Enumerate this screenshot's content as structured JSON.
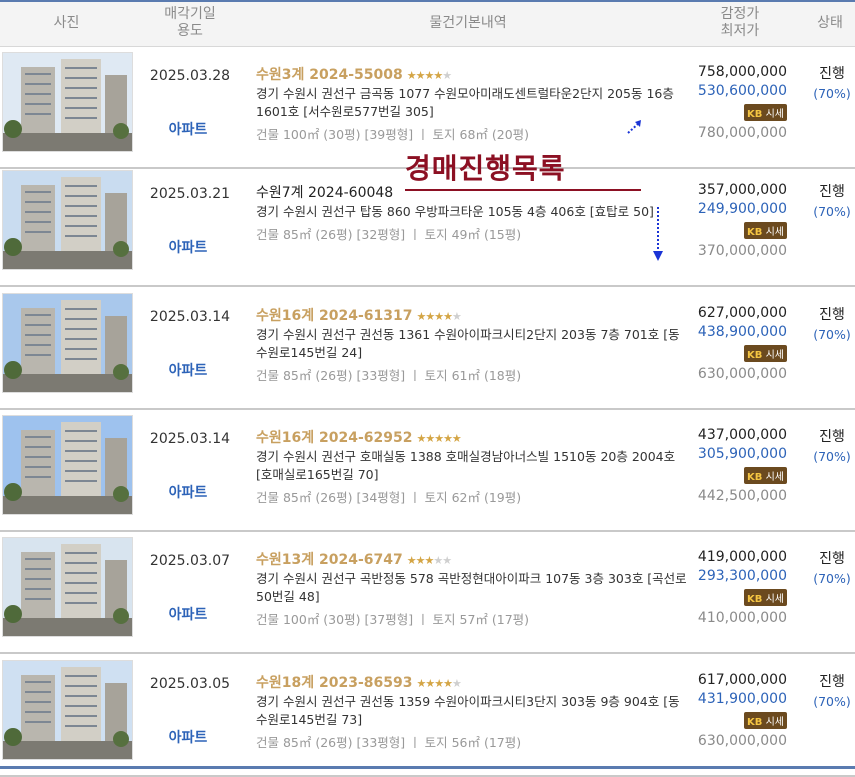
{
  "header": {
    "photo": "사진",
    "date_line1": "매각기일",
    "date_line2": "용도",
    "info": "물건기본내역",
    "price_line1": "감정가",
    "price_line2": "최저가",
    "status": "상태"
  },
  "overlay": {
    "title": "경매진행목록"
  },
  "rows": [
    {
      "date": "2025.03.28",
      "usage": "아파트",
      "case": "수원3계 2024-55008",
      "stars": 4,
      "case_style": "gold",
      "address": "경기 수원시 권선구 금곡동 1077 수원모아미래도센트럴타운2단지 205동 16층 1601호 [서수원로577번길 305]",
      "area": "건물 100㎡ (30평) [39평형]  ㅣ  토지 68㎡ (20평)",
      "appraisal": "758,000,000",
      "minimum": "530,600,000",
      "sale": "780,000,000",
      "sise": "시세",
      "status": "진행",
      "ratio": "(70%)"
    },
    {
      "date": "2025.03.21",
      "usage": "아파트",
      "case": "수원7계 2024-60048",
      "stars": 0,
      "case_style": "black",
      "address": "경기 수원시 권선구 탑동 860 우방파크타운 105동 4층 406호 [효탑로 50]",
      "area": "건물 85㎡ (26평) [32평형]  ㅣ  토지 49㎡ (15평)",
      "appraisal": "357,000,000",
      "minimum": "249,900,000",
      "sale": "370,000,000",
      "sise": "시세",
      "status": "진행",
      "ratio": "(70%)"
    },
    {
      "date": "2025.03.14",
      "usage": "아파트",
      "case": "수원16계 2024-61317",
      "stars": 4,
      "case_style": "gold",
      "address": "경기 수원시 권선구 권선동 1361 수원아이파크시티2단지 203동 7층 701호 [동수원로145번길 24]",
      "area": "건물 85㎡ (26평) [33평형]  ㅣ  토지 61㎡ (18평)",
      "appraisal": "627,000,000",
      "minimum": "438,900,000",
      "sale": "630,000,000",
      "sise": "시세",
      "status": "진행",
      "ratio": "(70%)"
    },
    {
      "date": "2025.03.14",
      "usage": "아파트",
      "case": "수원16계 2024-62952",
      "stars": 5,
      "case_style": "gold",
      "address": "경기 수원시 권선구 호매실동 1388 호매실경남아너스빌 1510동 20층 2004호 [호매실로165번길 70]",
      "area": "건물 85㎡ (26평) [34평형]  ㅣ  토지 62㎡ (19평)",
      "appraisal": "437,000,000",
      "minimum": "305,900,000",
      "sale": "442,500,000",
      "sise": "시세",
      "status": "진행",
      "ratio": "(70%)"
    },
    {
      "date": "2025.03.07",
      "usage": "아파트",
      "case": "수원13계 2024-6747",
      "stars": 3,
      "case_style": "gold",
      "address": "경기 수원시 권선구 곡반정동 578 곡반정현대아이파크 107동 3층 303호 [곡선로50번길 48]",
      "area": "건물 100㎡ (30평) [37평형]  ㅣ  토지 57㎡ (17평)",
      "appraisal": "419,000,000",
      "minimum": "293,300,000",
      "sale": "410,000,000",
      "sise": "시세",
      "status": "진행",
      "ratio": "(70%)"
    },
    {
      "date": "2025.03.05",
      "usage": "아파트",
      "case": "수원18계 2023-86593",
      "stars": 4,
      "case_style": "gold",
      "address": "경기 수원시 권선구 권선동 1359 수원아이파크시티3단지 303동 9층 904호 [동수원로145번길 73]",
      "area": "건물 85㎡ (26평) [33평형]  ㅣ  토지 56㎡ (17평)",
      "appraisal": "617,000,000",
      "minimum": "431,900,000",
      "sale": "630,000,000",
      "sise": "시세",
      "status": "진행",
      "ratio": "(70%)"
    }
  ]
}
